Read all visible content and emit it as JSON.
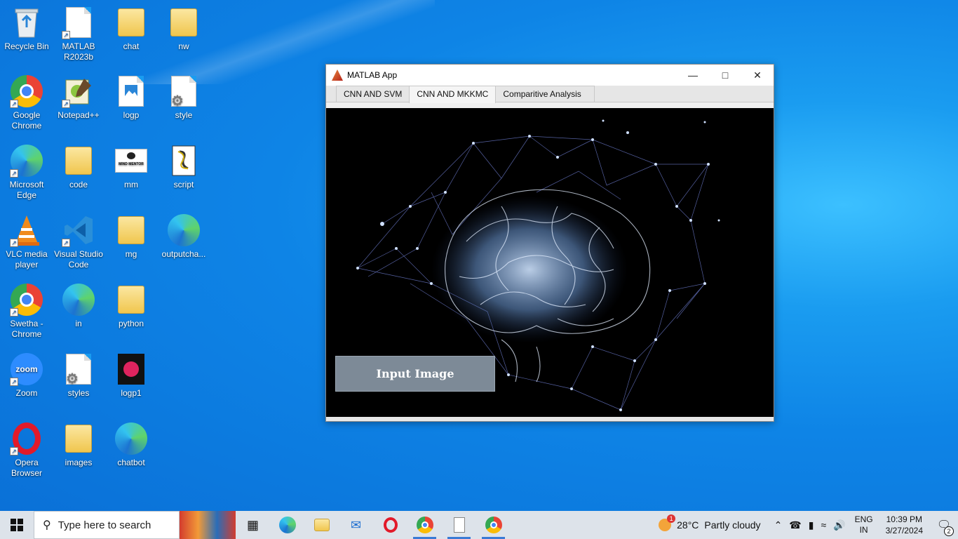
{
  "desktop": {
    "icons": [
      {
        "label": "Recycle Bin",
        "icon": "recycle-bin-icon"
      },
      {
        "label": "MATLAB R2023b",
        "icon": "document-icon"
      },
      {
        "label": "chat",
        "icon": "folder-icon"
      },
      {
        "label": "nw",
        "icon": "folder-icon"
      },
      {
        "label": "Google Chrome",
        "icon": "chrome-icon"
      },
      {
        "label": "Notepad++",
        "icon": "notepad-plus-plus-icon"
      },
      {
        "label": "logp",
        "icon": "image-file-icon"
      },
      {
        "label": "style",
        "icon": "settings-file-icon"
      },
      {
        "label": "Microsoft Edge",
        "icon": "edge-icon"
      },
      {
        "label": "code",
        "icon": "folder-icon"
      },
      {
        "label": "mm",
        "icon": "image-thumbnail-icon"
      },
      {
        "label": "script",
        "icon": "script-file-icon"
      },
      {
        "label": "VLC media player",
        "icon": "vlc-icon"
      },
      {
        "label": "Visual Studio Code",
        "icon": "vscode-icon"
      },
      {
        "label": "mg",
        "icon": "folder-icon"
      },
      {
        "label": "outputcha...",
        "icon": "edge-icon"
      },
      {
        "label": "Swetha - Chrome",
        "icon": "chrome-icon"
      },
      {
        "label": "in",
        "icon": "edge-icon"
      },
      {
        "label": "python",
        "icon": "folder-icon"
      },
      {
        "label": "Zoom",
        "icon": "zoom-icon"
      },
      {
        "label": "styles",
        "icon": "settings-file-icon"
      },
      {
        "label": "logp1",
        "icon": "image-thumbnail-icon"
      },
      {
        "label": "Opera Browser",
        "icon": "opera-icon"
      },
      {
        "label": "images",
        "icon": "folder-icon"
      },
      {
        "label": "chatbot",
        "icon": "edge-icon"
      }
    ],
    "mm_thumb_text": "MIND MENTOR"
  },
  "window": {
    "title": "MATLAB App",
    "minimize_glyph": "—",
    "maximize_glyph": "□",
    "close_glyph": "✕",
    "tabs": [
      "CNN AND SVM",
      "CNN AND MKKMC",
      "Comparitive Analysis"
    ],
    "active_tab": "CNN AND MKKMC",
    "input_button_label": "Input Image"
  },
  "taskbar": {
    "search_placeholder": "Type here to search",
    "weather_temp": "28°C",
    "weather_desc": "Partly cloudy",
    "weather_badge": "1",
    "lang_line1": "ENG",
    "lang_line2": "IN",
    "time": "10:39 PM",
    "date": "3/27/2024",
    "notification_count": "2"
  }
}
